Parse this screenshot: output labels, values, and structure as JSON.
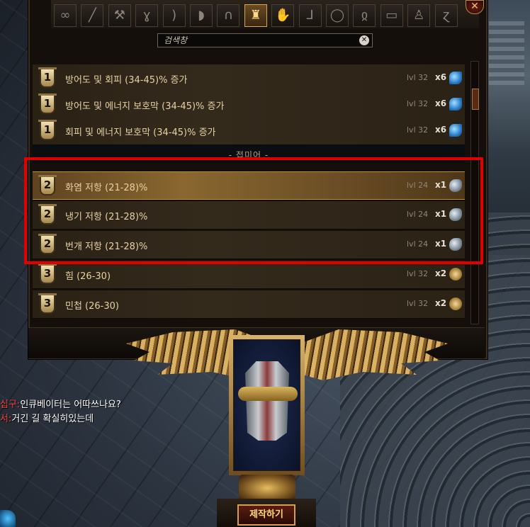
{
  "tabs": [
    {
      "icon": "infinity-icon",
      "glyph": "∞"
    },
    {
      "icon": "sword-icon",
      "glyph": "╱"
    },
    {
      "icon": "axe-icon",
      "glyph": "⚒"
    },
    {
      "icon": "claw-icon",
      "glyph": "ɣ"
    },
    {
      "icon": "bow-icon",
      "glyph": ")"
    },
    {
      "icon": "shield-icon",
      "glyph": "◗"
    },
    {
      "icon": "helmet-icon",
      "glyph": "∩"
    },
    {
      "icon": "body-armour-icon",
      "glyph": "♜",
      "active": true
    },
    {
      "icon": "gloves-icon",
      "glyph": "✋"
    },
    {
      "icon": "boots-icon",
      "glyph": "⅃"
    },
    {
      "icon": "ring-icon",
      "glyph": "◯"
    },
    {
      "icon": "amulet-icon",
      "glyph": "ჲ"
    },
    {
      "icon": "belt-icon",
      "glyph": "▭"
    },
    {
      "icon": "flask-icon",
      "glyph": "♙"
    },
    {
      "icon": "jewel-icon",
      "glyph": "ɀ"
    }
  ],
  "search": {
    "placeholder": "검색창",
    "clear_glyph": "✕"
  },
  "close_glyph": "✕",
  "rows_top": [
    {
      "tier": "1",
      "label": "방어도 및 회피 (34-45)% 증가",
      "level": "lvl 32",
      "qty": "x6",
      "currency": "regal"
    },
    {
      "tier": "1",
      "label": "방어도 및 에너지 보호막 (34-45)% 증가",
      "level": "lvl 32",
      "qty": "x6",
      "currency": "regal"
    },
    {
      "tier": "1",
      "label": "회피 및 에너지 보호막 (34-45)% 증가",
      "level": "lvl 32",
      "qty": "x6",
      "currency": "regal"
    }
  ],
  "divider": "- 접미어 -",
  "rows_bottom": [
    {
      "tier": "2",
      "label": "화염 저항 (21-28)%",
      "level": "lvl 24",
      "qty": "x1",
      "currency": "trans",
      "selected": true
    },
    {
      "tier": "2",
      "label": "냉기 저항 (21-28)%",
      "level": "lvl 24",
      "qty": "x1",
      "currency": "trans"
    },
    {
      "tier": "2",
      "label": "번개 저항 (21-28)%",
      "level": "lvl 24",
      "qty": "x1",
      "currency": "trans"
    },
    {
      "tier": "3",
      "label": "힘 (26-30)",
      "level": "lvl 32",
      "qty": "x2",
      "currency": "aug"
    },
    {
      "tier": "3",
      "label": "민첩 (26-30)",
      "level": "lvl 32",
      "qty": "x2",
      "currency": "aug"
    }
  ],
  "craft_button": "제작하기",
  "chat": [
    {
      "name": "십구",
      "sep": ":",
      "message": "인큐베이터는 어따쓰나요?"
    },
    {
      "name": "서",
      "sep": ":",
      "message": "거긴 길 확실히있는데"
    }
  ],
  "colors": {
    "highlight": "#e10000",
    "accent_gold": "#d8a44e",
    "chat_name": "#ff4040"
  }
}
